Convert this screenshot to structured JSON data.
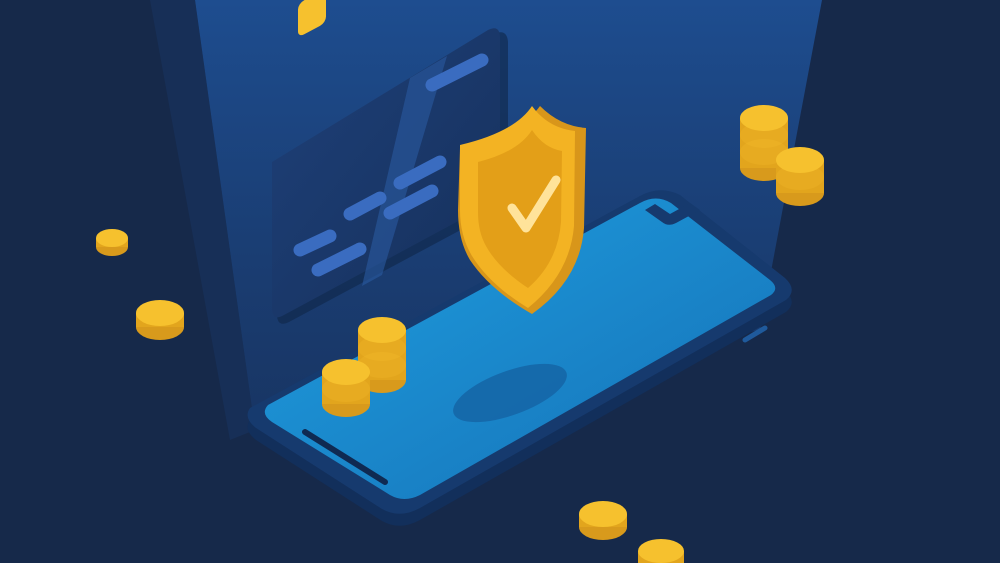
{
  "scene": {
    "subject": "secure-mobile-payment-illustration",
    "colors": {
      "background": "#16294a",
      "background_glow": "#1d4a8c",
      "phone_screen": "#1a8fd0",
      "phone_body": "#163a6e",
      "card": "#1b3a6a",
      "coin": "#f6c12e",
      "shield": "#f3b323",
      "check": "#ffe39a"
    },
    "icons": [
      "shield-check-icon",
      "credit-card-icon",
      "smartphone-icon",
      "coin-icon"
    ],
    "coin_count": 14
  }
}
